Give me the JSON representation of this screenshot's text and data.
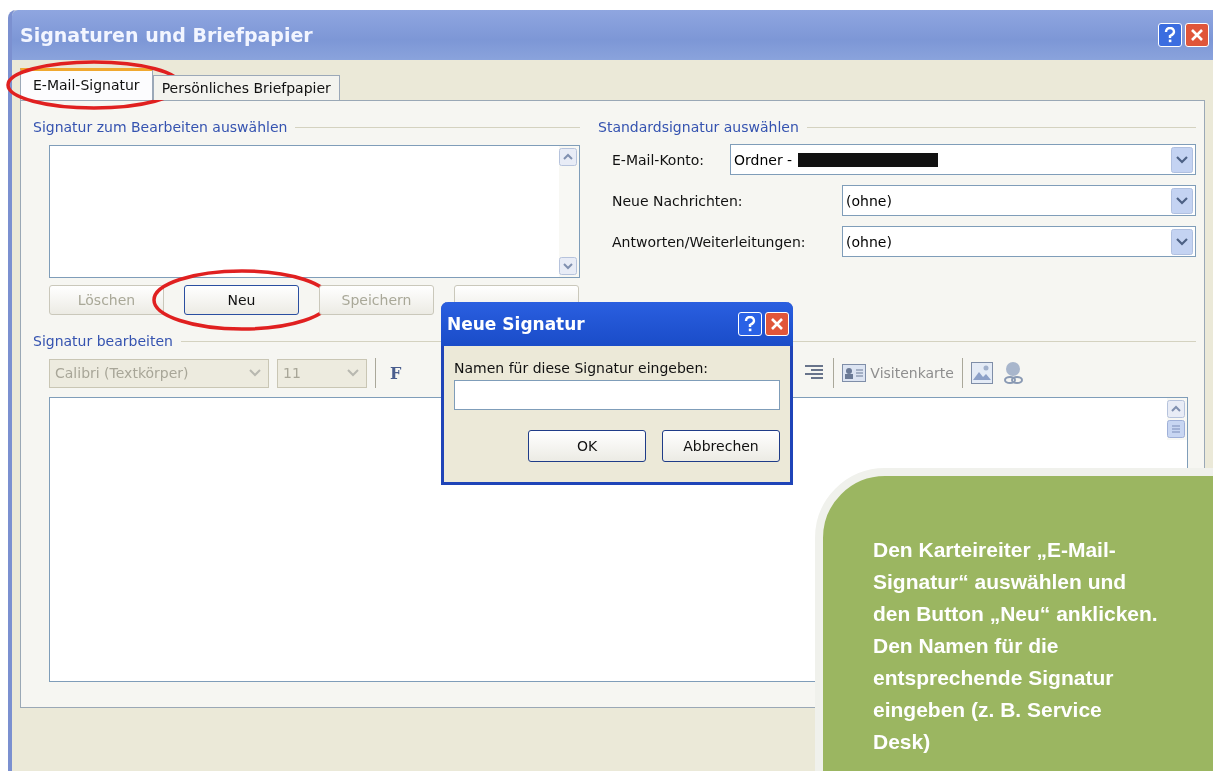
{
  "window": {
    "title": "Signaturen und Briefpapier"
  },
  "tabs": [
    {
      "label": "E-Mail-Signatur",
      "selected": true,
      "highlighted": true
    },
    {
      "label": "Persönliches Briefpapier",
      "selected": false,
      "highlighted": false
    }
  ],
  "select_group": {
    "title": "Signatur zum Bearbeiten auswählen",
    "buttons": [
      {
        "label": "Löschen",
        "disabled": true,
        "highlighted": false
      },
      {
        "label": "Neu",
        "disabled": false,
        "highlighted": true
      },
      {
        "label": "Speichern",
        "disabled": true,
        "highlighted": false
      },
      {
        "disabled": true,
        "highlighted": false
      }
    ]
  },
  "default_group": {
    "title": "Standardsignatur auswählen",
    "fields": [
      {
        "label": "E-Mail-Konto:",
        "value": "Ordner -",
        "redacted": true
      },
      {
        "label": "Neue Nachrichten:",
        "value": "(ohne)",
        "redacted": false
      },
      {
        "label": "Antworten/Weiterleitungen:",
        "value": "(ohne)",
        "redacted": false
      }
    ]
  },
  "edit_group": {
    "title": "Signatur bearbeiten",
    "font": "Calibri (Textkörper)",
    "size": "11",
    "bold_label": "F",
    "vcard_label": "Visitenkarte"
  },
  "dialog": {
    "title": "Neue Signatur",
    "prompt": "Namen für diese Signatur eingeben:",
    "buttons": [
      "OK",
      "Abbrechen"
    ]
  },
  "callout": {
    "text": "Den Karteireiter „E-Mail-Signatur“ auswählen und den Button „Neu“ anklicken. Den Namen für die entsprechende Signatur eingeben (z. B. Service Desk)"
  }
}
